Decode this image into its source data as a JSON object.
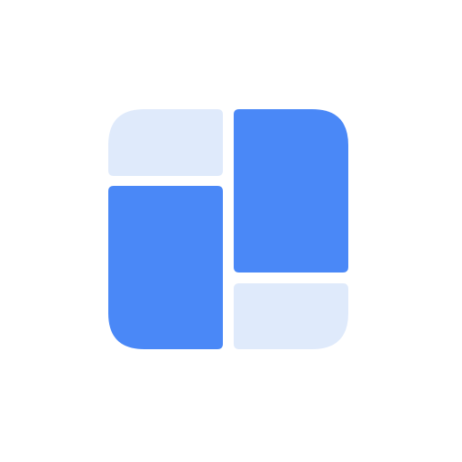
{
  "logo": {
    "icon": "dashboard-layout-icon",
    "colors": {
      "primary": "#4A88F7",
      "light": "#DFEAFB",
      "background": "#FFFFFF"
    }
  }
}
